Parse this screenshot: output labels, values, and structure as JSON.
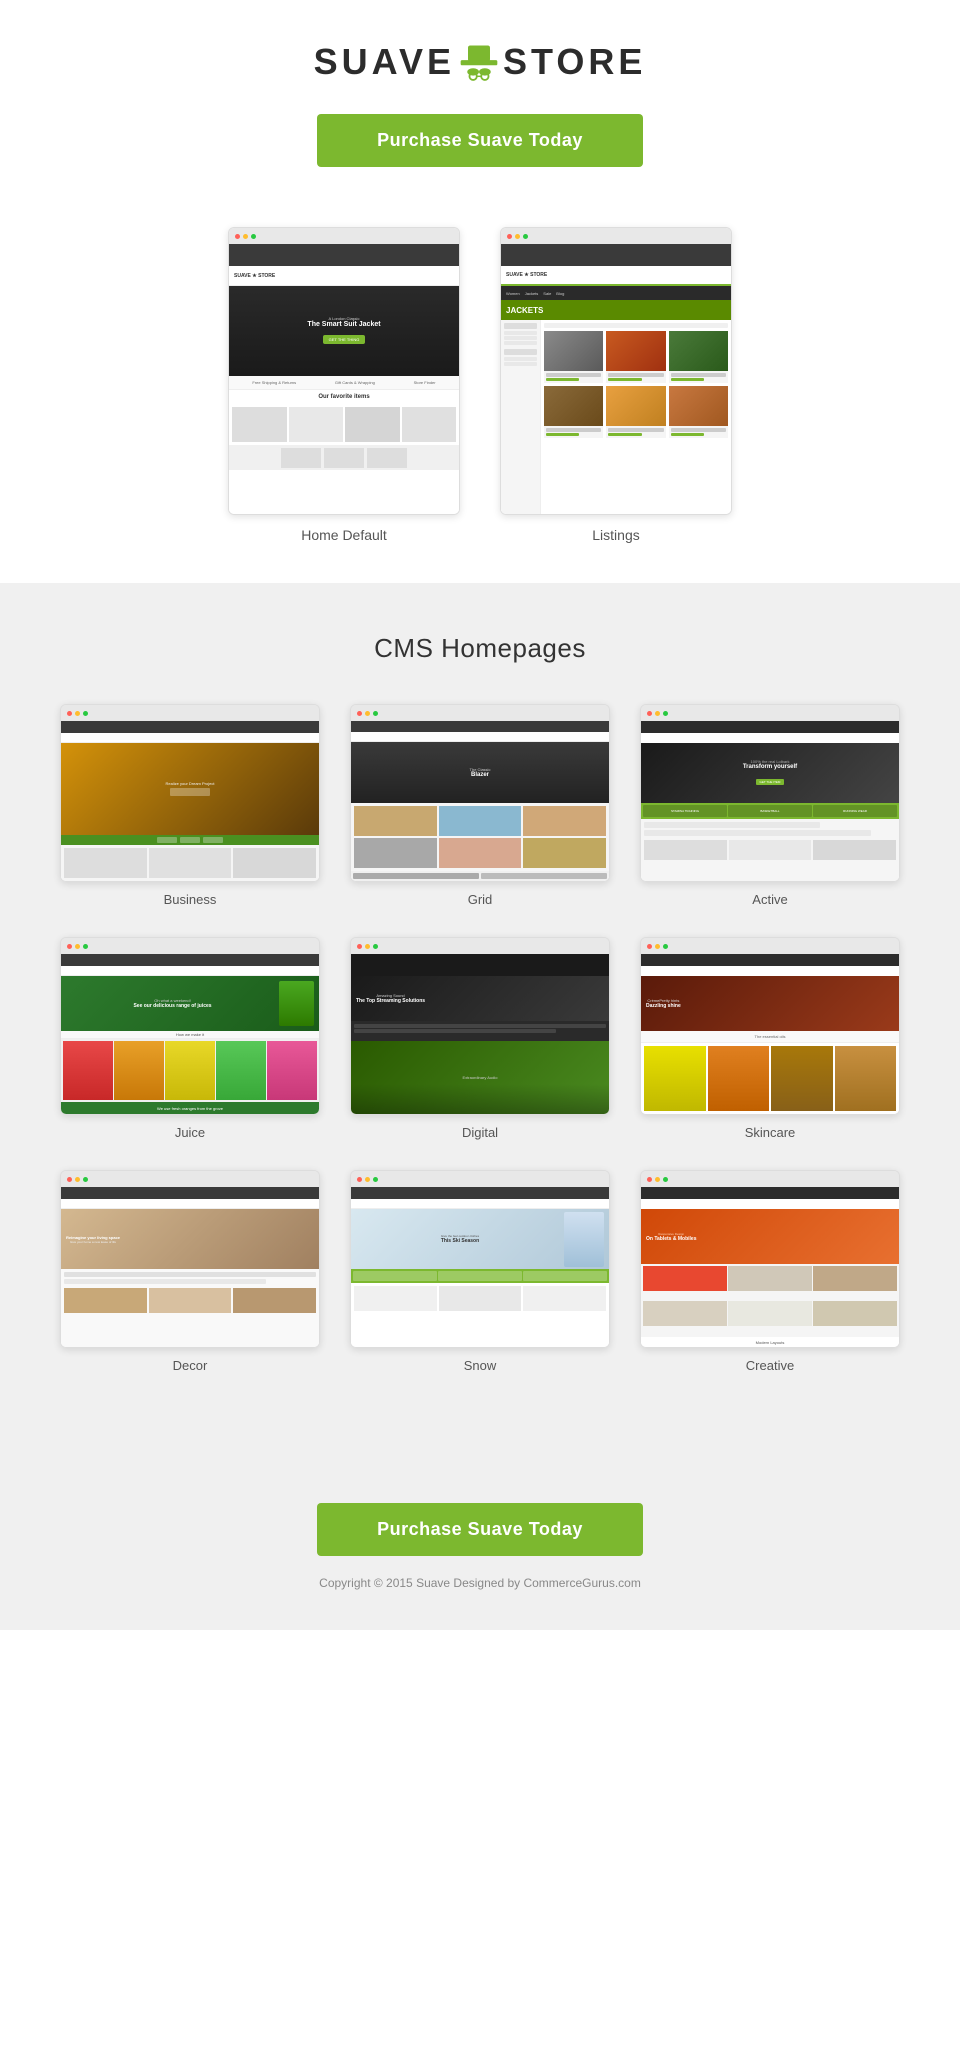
{
  "header": {
    "logo_suave": "SUAVE",
    "logo_store": "STORE"
  },
  "cta": {
    "button_label": "Purchase Suave Today",
    "button_label_bottom": "Purchase Suave Today"
  },
  "top_previews": [
    {
      "id": "home-default",
      "label": "Home Default"
    },
    {
      "id": "listings",
      "label": "Listings"
    }
  ],
  "cms": {
    "section_title": "CMS Homepages",
    "items": [
      {
        "id": "business",
        "label": "Business"
      },
      {
        "id": "grid",
        "label": "Grid"
      },
      {
        "id": "active",
        "label": "Active"
      },
      {
        "id": "juice",
        "label": "Juice"
      },
      {
        "id": "digital",
        "label": "Digital"
      },
      {
        "id": "skincare",
        "label": "Skincare"
      },
      {
        "id": "decor",
        "label": "Decor"
      },
      {
        "id": "snow",
        "label": "Snow"
      },
      {
        "id": "creative",
        "label": "Creative"
      }
    ]
  },
  "footer": {
    "copyright": "Copyright © 2015 Suave Designed by CommerceGurus.com"
  }
}
